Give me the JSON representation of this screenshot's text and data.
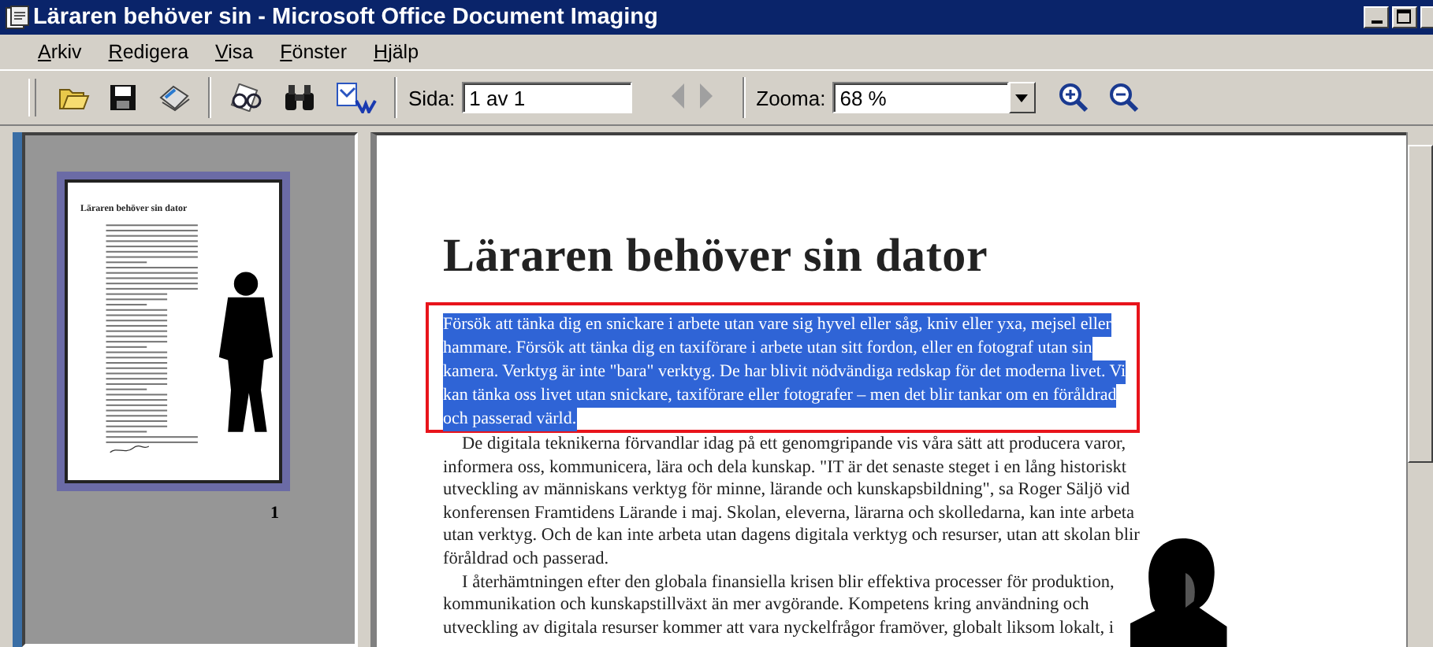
{
  "window": {
    "title": "Läraren behöver sin - Microsoft Office Document Imaging"
  },
  "menu": [
    "Arkiv",
    "Redigera",
    "Visa",
    "Fönster",
    "Hjälp"
  ],
  "toolbar": {
    "page_label": "Sida:",
    "page_field": {
      "value": "1 av 1"
    },
    "prev": {
      "disabled": true
    },
    "next": {
      "disabled": true
    },
    "zoom_label": "Zooma:",
    "zoom_field": {
      "value": "68 %"
    }
  },
  "thumbnails": [
    {
      "title": "Läraren behöver sin dator",
      "number": "1",
      "selected": true
    }
  ],
  "document": {
    "title": "Läraren behöver sin dator",
    "paragraphs": [
      {
        "selected": true,
        "indent": false,
        "lines": [
          "Försök att tänka dig en snickare i arbete utan vare sig hyvel eller såg, kniv eller yxa, mejsel eller",
          "hammare. Försök att tänka dig en taxiförare i arbete utan sitt fordon, eller en fotograf utan sin",
          "kamera. Verktyg är inte \"bara\" verktyg. De har blivit nödvändiga redskap för det moderna livet. Vi",
          "kan tänka oss livet utan snickare, taxiförare eller fotografer – men det blir tankar om en föråldrad",
          "och passerad värld."
        ]
      },
      {
        "selected": false,
        "indent": true,
        "lines": [
          "De digitala teknikerna förvandlar idag på ett genomgripande vis våra sätt att producera varor,",
          "informera oss, kommunicera, lära och dela kunskap. \"IT är det senaste steget i en lång historiskt",
          "utveckling av människans verktyg för minne, lärande och kunskapsbildning\", sa  Roger Säljö vid",
          "konferensen Framtidens Lärande i maj. Skolan, eleverna, lärarna och skolledarna, kan inte arbeta",
          "utan verktyg. Och de kan inte arbeta utan dagens digitala verktyg och resurser, utan att skolan blir",
          "föråldrad och passerad."
        ]
      },
      {
        "selected": false,
        "indent": true,
        "lines": [
          "I återhämtningen efter den globala finansiella krisen blir effektiva processer för produktion,",
          "kommunikation och kunskapstillväxt än mer avgörande. Kompetens kring användning och",
          "utveckling av digitala resurser kommer att vara nyckelfrågor framöver, globalt liksom lokalt, i"
        ]
      }
    ]
  }
}
